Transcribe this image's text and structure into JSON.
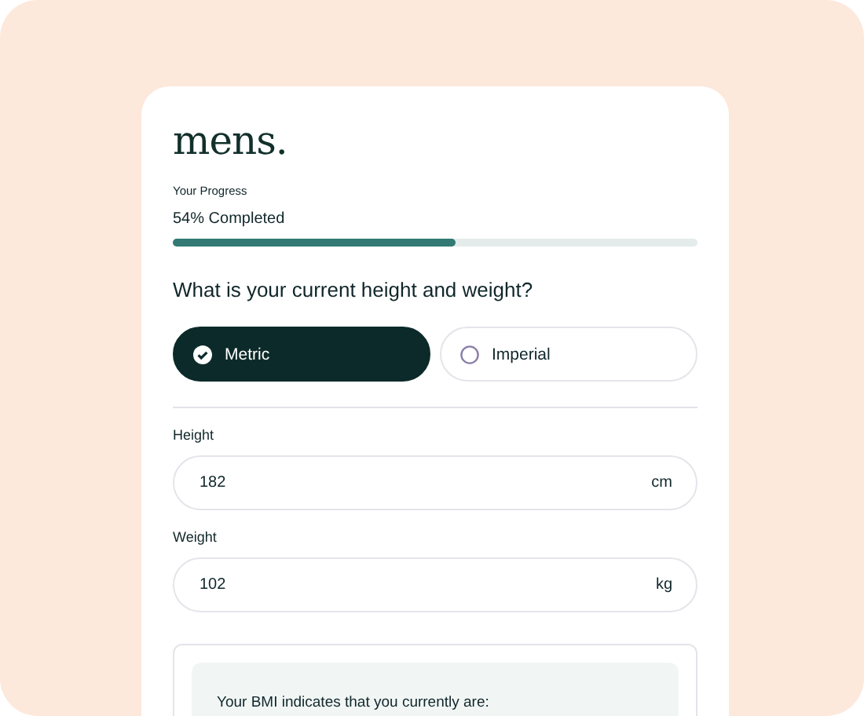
{
  "logo": "mens.",
  "progress": {
    "label": "Your Progress",
    "status": "54% Completed",
    "level": 0.54
  },
  "question": "What is your current height and weight?",
  "unit_options": [
    {
      "label": "Metric",
      "selected": true
    },
    {
      "label": "Imperial",
      "selected": false
    }
  ],
  "fields": [
    {
      "label": "Height",
      "value": "182",
      "unit": "cm"
    },
    {
      "label": "Weight",
      "value": "102",
      "unit": "kg"
    }
  ],
  "result": {
    "text": "Your BMI indicates that you currently are:"
  }
}
